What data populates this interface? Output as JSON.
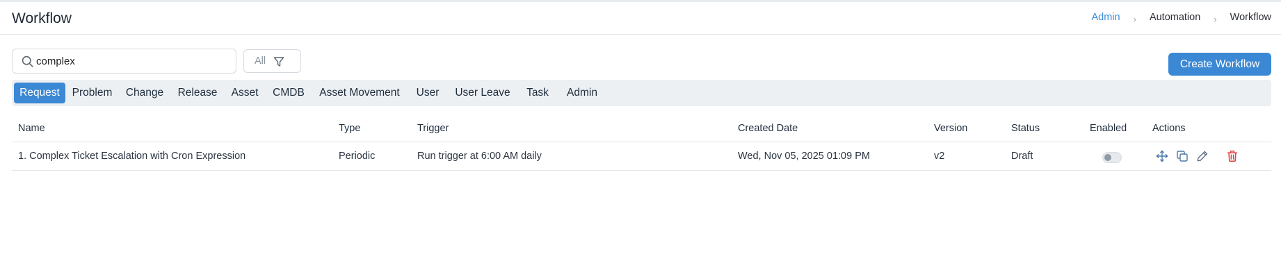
{
  "header": {
    "title": "Workflow",
    "breadcrumb": [
      "Admin",
      "Automation",
      "Workflow"
    ],
    "breadcrumb_sep": "›"
  },
  "toolbar": {
    "search_value": "complex",
    "filter_label": "All",
    "create_button": "Create Workflow"
  },
  "tabs": [
    "Request",
    "Problem",
    "Change",
    "Release",
    "Asset",
    "CMDB",
    "Asset Movement",
    "User",
    "User Leave",
    "Task",
    "Admin"
  ],
  "active_tab": "Request",
  "table": {
    "columns": [
      "Name",
      "Type",
      "Trigger",
      "Created Date",
      "Version",
      "Status",
      "Enabled",
      "Actions"
    ],
    "rows": [
      {
        "name": "1. Complex Ticket Escalation with Cron Expression",
        "type": "Periodic",
        "trigger": "Run trigger at 6:00 AM daily",
        "created_date": "Wed, Nov 05, 2025 01:09 PM",
        "version": "v2",
        "status": "Draft",
        "enabled": false,
        "actions": [
          "move-icon",
          "copy-icon",
          "edit-icon",
          "delete-icon"
        ]
      }
    ]
  },
  "colors": {
    "accent": "#3b88d4",
    "danger": "#e03b3b",
    "icon": "#4a78a8"
  }
}
